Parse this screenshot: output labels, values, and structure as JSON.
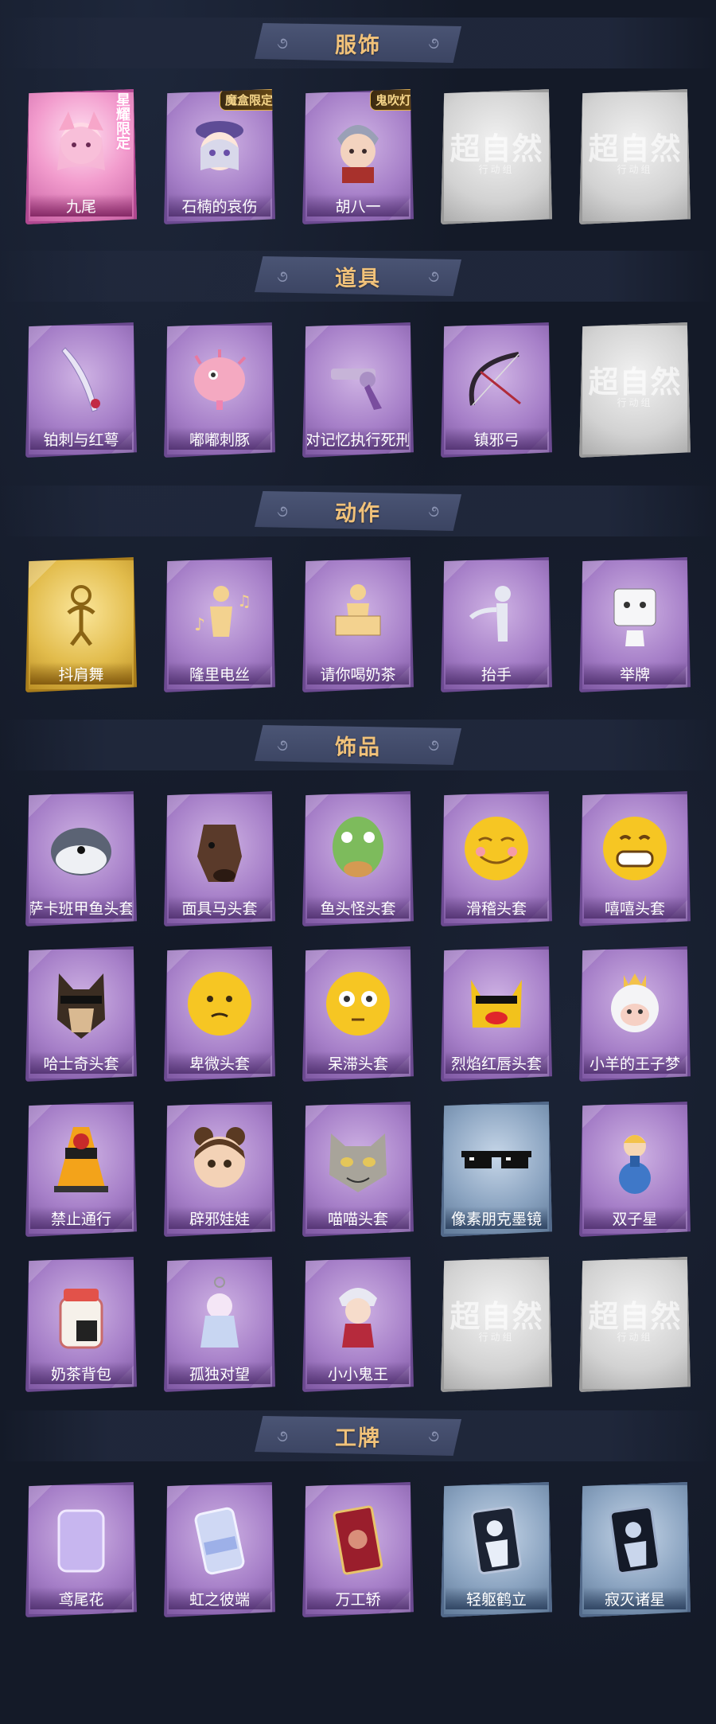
{
  "sections": [
    {
      "title": "服饰",
      "items": [
        {
          "label": "九尾",
          "style": "pink",
          "icon": "fox-girl-portrait-icon",
          "badge": "星耀限定",
          "badge_type": "vert"
        },
        {
          "label": "石楠的哀伤",
          "style": "purple",
          "icon": "girl-hat-portrait-icon",
          "badge": "魔盒限定",
          "badge_type": "top"
        },
        {
          "label": "胡八一",
          "style": "purple",
          "icon": "boy-portrait-icon",
          "badge": "鬼吹灯",
          "badge_type": "top"
        },
        {
          "label": "",
          "style": "grey",
          "icon": "placeholder-logo-icon",
          "placeholder": "超自然",
          "placeholder_sub": "行动组"
        },
        {
          "label": "",
          "style": "grey",
          "icon": "placeholder-logo-icon",
          "placeholder": "超自然",
          "placeholder_sub": "行动组"
        }
      ]
    },
    {
      "title": "道具",
      "items": [
        {
          "label": "铂刺与红萼",
          "style": "purple",
          "icon": "blade-icon"
        },
        {
          "label": "嘟嘟刺豚",
          "style": "purple",
          "icon": "pufferfish-icon"
        },
        {
          "label": "对记忆执行死刑",
          "style": "purple",
          "icon": "revolver-icon"
        },
        {
          "label": "镇邪弓",
          "style": "purple",
          "icon": "bow-icon"
        },
        {
          "label": "",
          "style": "grey",
          "icon": "placeholder-logo-icon",
          "placeholder": "超自然",
          "placeholder_sub": "行动组"
        }
      ]
    },
    {
      "title": "动作",
      "items": [
        {
          "label": "抖肩舞",
          "style": "gold",
          "icon": "dance-pose-icon"
        },
        {
          "label": "隆里电丝",
          "style": "purple",
          "icon": "music-pose-icon"
        },
        {
          "label": "请你喝奶茶",
          "style": "purple",
          "icon": "sign-pose-icon"
        },
        {
          "label": "抬手",
          "style": "purple",
          "icon": "raise-hand-pose-icon"
        },
        {
          "label": "举牌",
          "style": "purple",
          "icon": "hold-sign-pose-icon"
        }
      ]
    },
    {
      "title": "饰品",
      "items": [
        {
          "label": "萨卡班甲鱼头套",
          "style": "purple",
          "icon": "fish-head-icon"
        },
        {
          "label": "面具马头套",
          "style": "purple",
          "icon": "horse-head-icon"
        },
        {
          "label": "鱼头怪头套",
          "style": "purple",
          "icon": "green-fish-head-icon"
        },
        {
          "label": "滑稽头套",
          "style": "purple",
          "icon": "funny-face-icon"
        },
        {
          "label": "嘻嘻头套",
          "style": "purple",
          "icon": "grin-face-icon"
        },
        {
          "label": "哈士奇头套",
          "style": "purple",
          "icon": "husky-head-icon"
        },
        {
          "label": "卑微头套",
          "style": "purple",
          "icon": "humble-face-icon"
        },
        {
          "label": "呆滞头套",
          "style": "purple",
          "icon": "dazed-face-icon"
        },
        {
          "label": "烈焰红唇头套",
          "style": "purple",
          "icon": "red-lips-head-icon"
        },
        {
          "label": "小羊的王子梦",
          "style": "purple",
          "icon": "sheep-crown-icon"
        },
        {
          "label": "禁止通行",
          "style": "purple",
          "icon": "traffic-cone-icon"
        },
        {
          "label": "辟邪娃娃",
          "style": "purple",
          "icon": "doll-head-icon"
        },
        {
          "label": "喵喵头套",
          "style": "purple",
          "icon": "cat-head-icon"
        },
        {
          "label": "像素朋克墨镜",
          "style": "blue",
          "icon": "pixel-sunglasses-icon"
        },
        {
          "label": "双子星",
          "style": "purple",
          "icon": "twin-star-icon"
        },
        {
          "label": "奶茶背包",
          "style": "purple",
          "icon": "milk-tea-bag-icon"
        },
        {
          "label": "孤独对望",
          "style": "purple",
          "icon": "keychain-figure-icon"
        },
        {
          "label": "小小鬼王",
          "style": "purple",
          "icon": "ghost-king-figure-icon"
        },
        {
          "label": "",
          "style": "grey",
          "icon": "placeholder-logo-icon",
          "placeholder": "超自然",
          "placeholder_sub": "行动组"
        },
        {
          "label": "",
          "style": "grey",
          "icon": "placeholder-logo-icon",
          "placeholder": "超自然",
          "placeholder_sub": "行动组"
        }
      ]
    },
    {
      "title": "工牌",
      "items": [
        {
          "label": "鸢尾花",
          "style": "purple",
          "icon": "badge-card-icon"
        },
        {
          "label": "虹之彼端",
          "style": "purple",
          "icon": "rainbow-card-icon"
        },
        {
          "label": "万工轿",
          "style": "purple",
          "icon": "red-card-icon"
        },
        {
          "label": "轻躯鹤立",
          "style": "blue",
          "icon": "silhouette-card-icon"
        },
        {
          "label": "寂灭诸星",
          "style": "blue",
          "icon": "silhouette-card-dark-icon"
        }
      ]
    }
  ]
}
